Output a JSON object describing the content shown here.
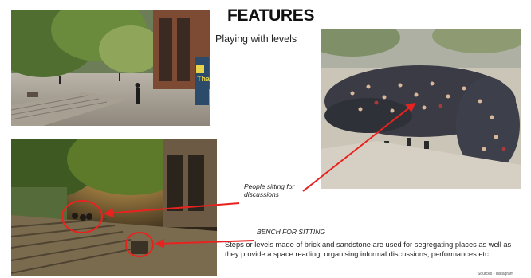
{
  "slide": {
    "title": "FEATURES",
    "subtitle": "Playing with levels",
    "annotation_people": "People sitting for discussions",
    "annotation_bench": "BENCH FOR SITTING",
    "description": "Steps or levels made of brick and sandstone are used for segregating places as well as they provide a space reading, organising informal discussions, performances etc.",
    "source": "Sources - Instagram",
    "accent_color": "#e8231f"
  },
  "photos": {
    "top_left": {
      "subject": "courtyard-steps-day",
      "sign_text": "Tha"
    },
    "bottom_left": {
      "subject": "steps-night"
    },
    "right": {
      "subject": "crowd-sitting-discussion"
    }
  }
}
